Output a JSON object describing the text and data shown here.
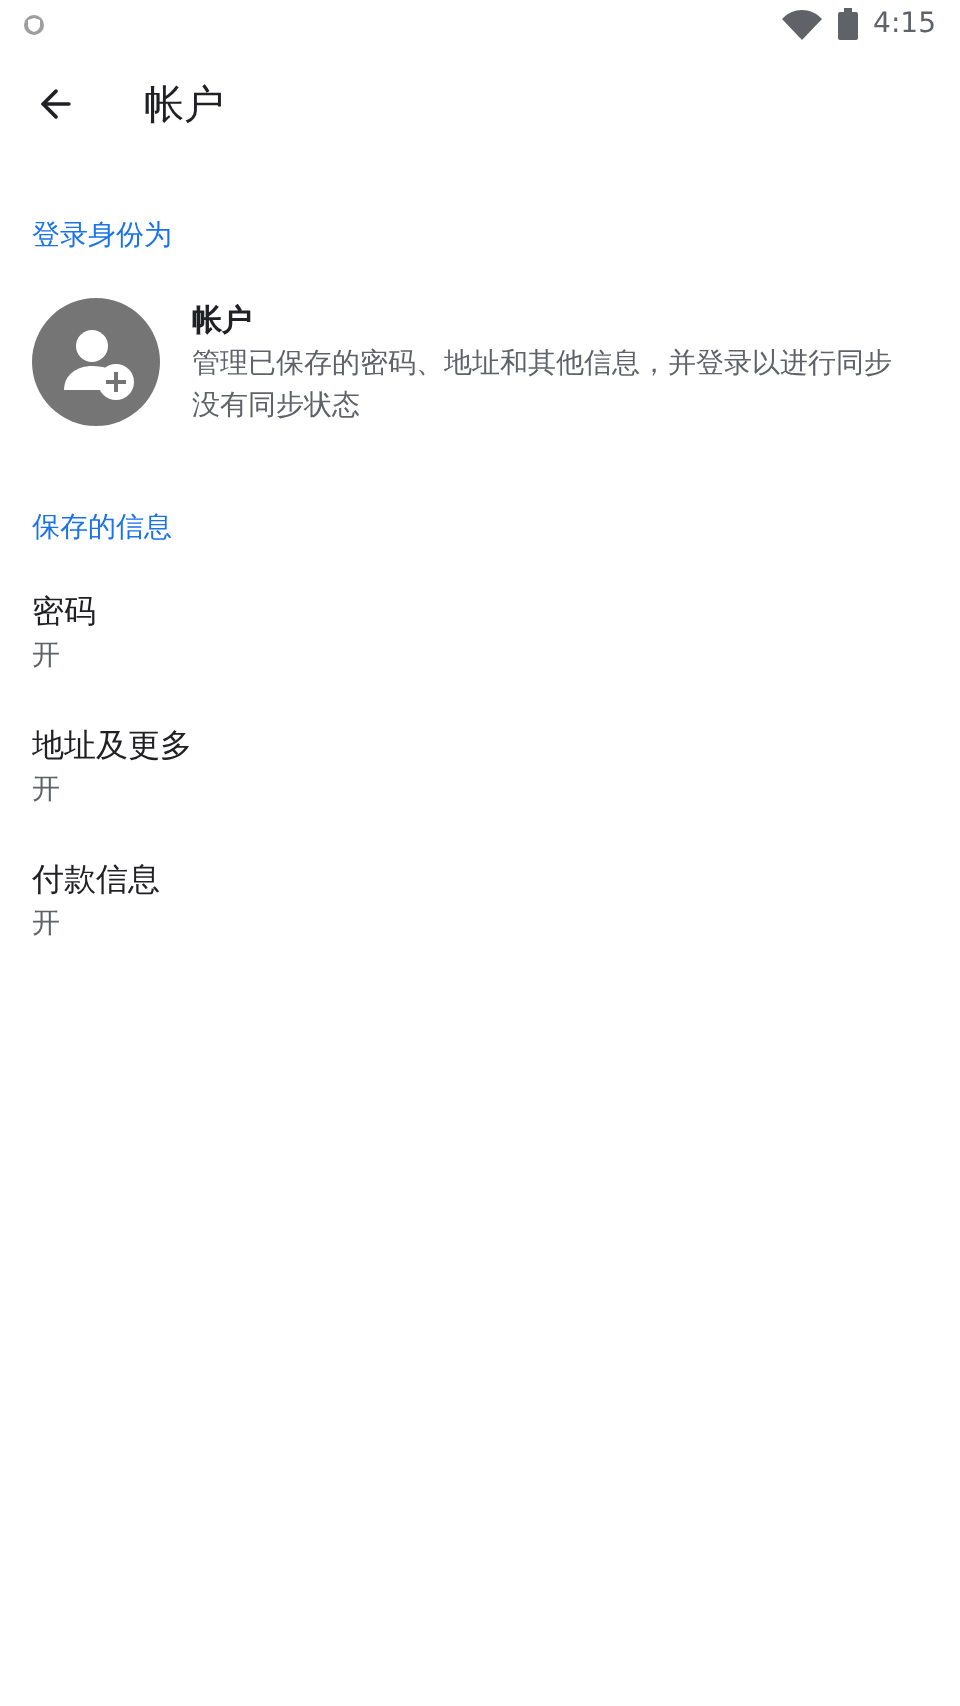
{
  "status_bar": {
    "time": "4:15"
  },
  "header": {
    "title": "帐户"
  },
  "sections": [
    {
      "heading": "登录身份为",
      "kind": "account",
      "account": {
        "name": "帐户",
        "description": "管理已保存的密码、地址和其他信息，并登录以进行同步",
        "sync_status": "没有同步状态"
      }
    },
    {
      "heading": "保存的信息",
      "kind": "list",
      "items": [
        {
          "title": "密码",
          "subtitle": "开"
        },
        {
          "title": "地址及更多",
          "subtitle": "开"
        },
        {
          "title": "付款信息",
          "subtitle": "开"
        }
      ]
    }
  ]
}
